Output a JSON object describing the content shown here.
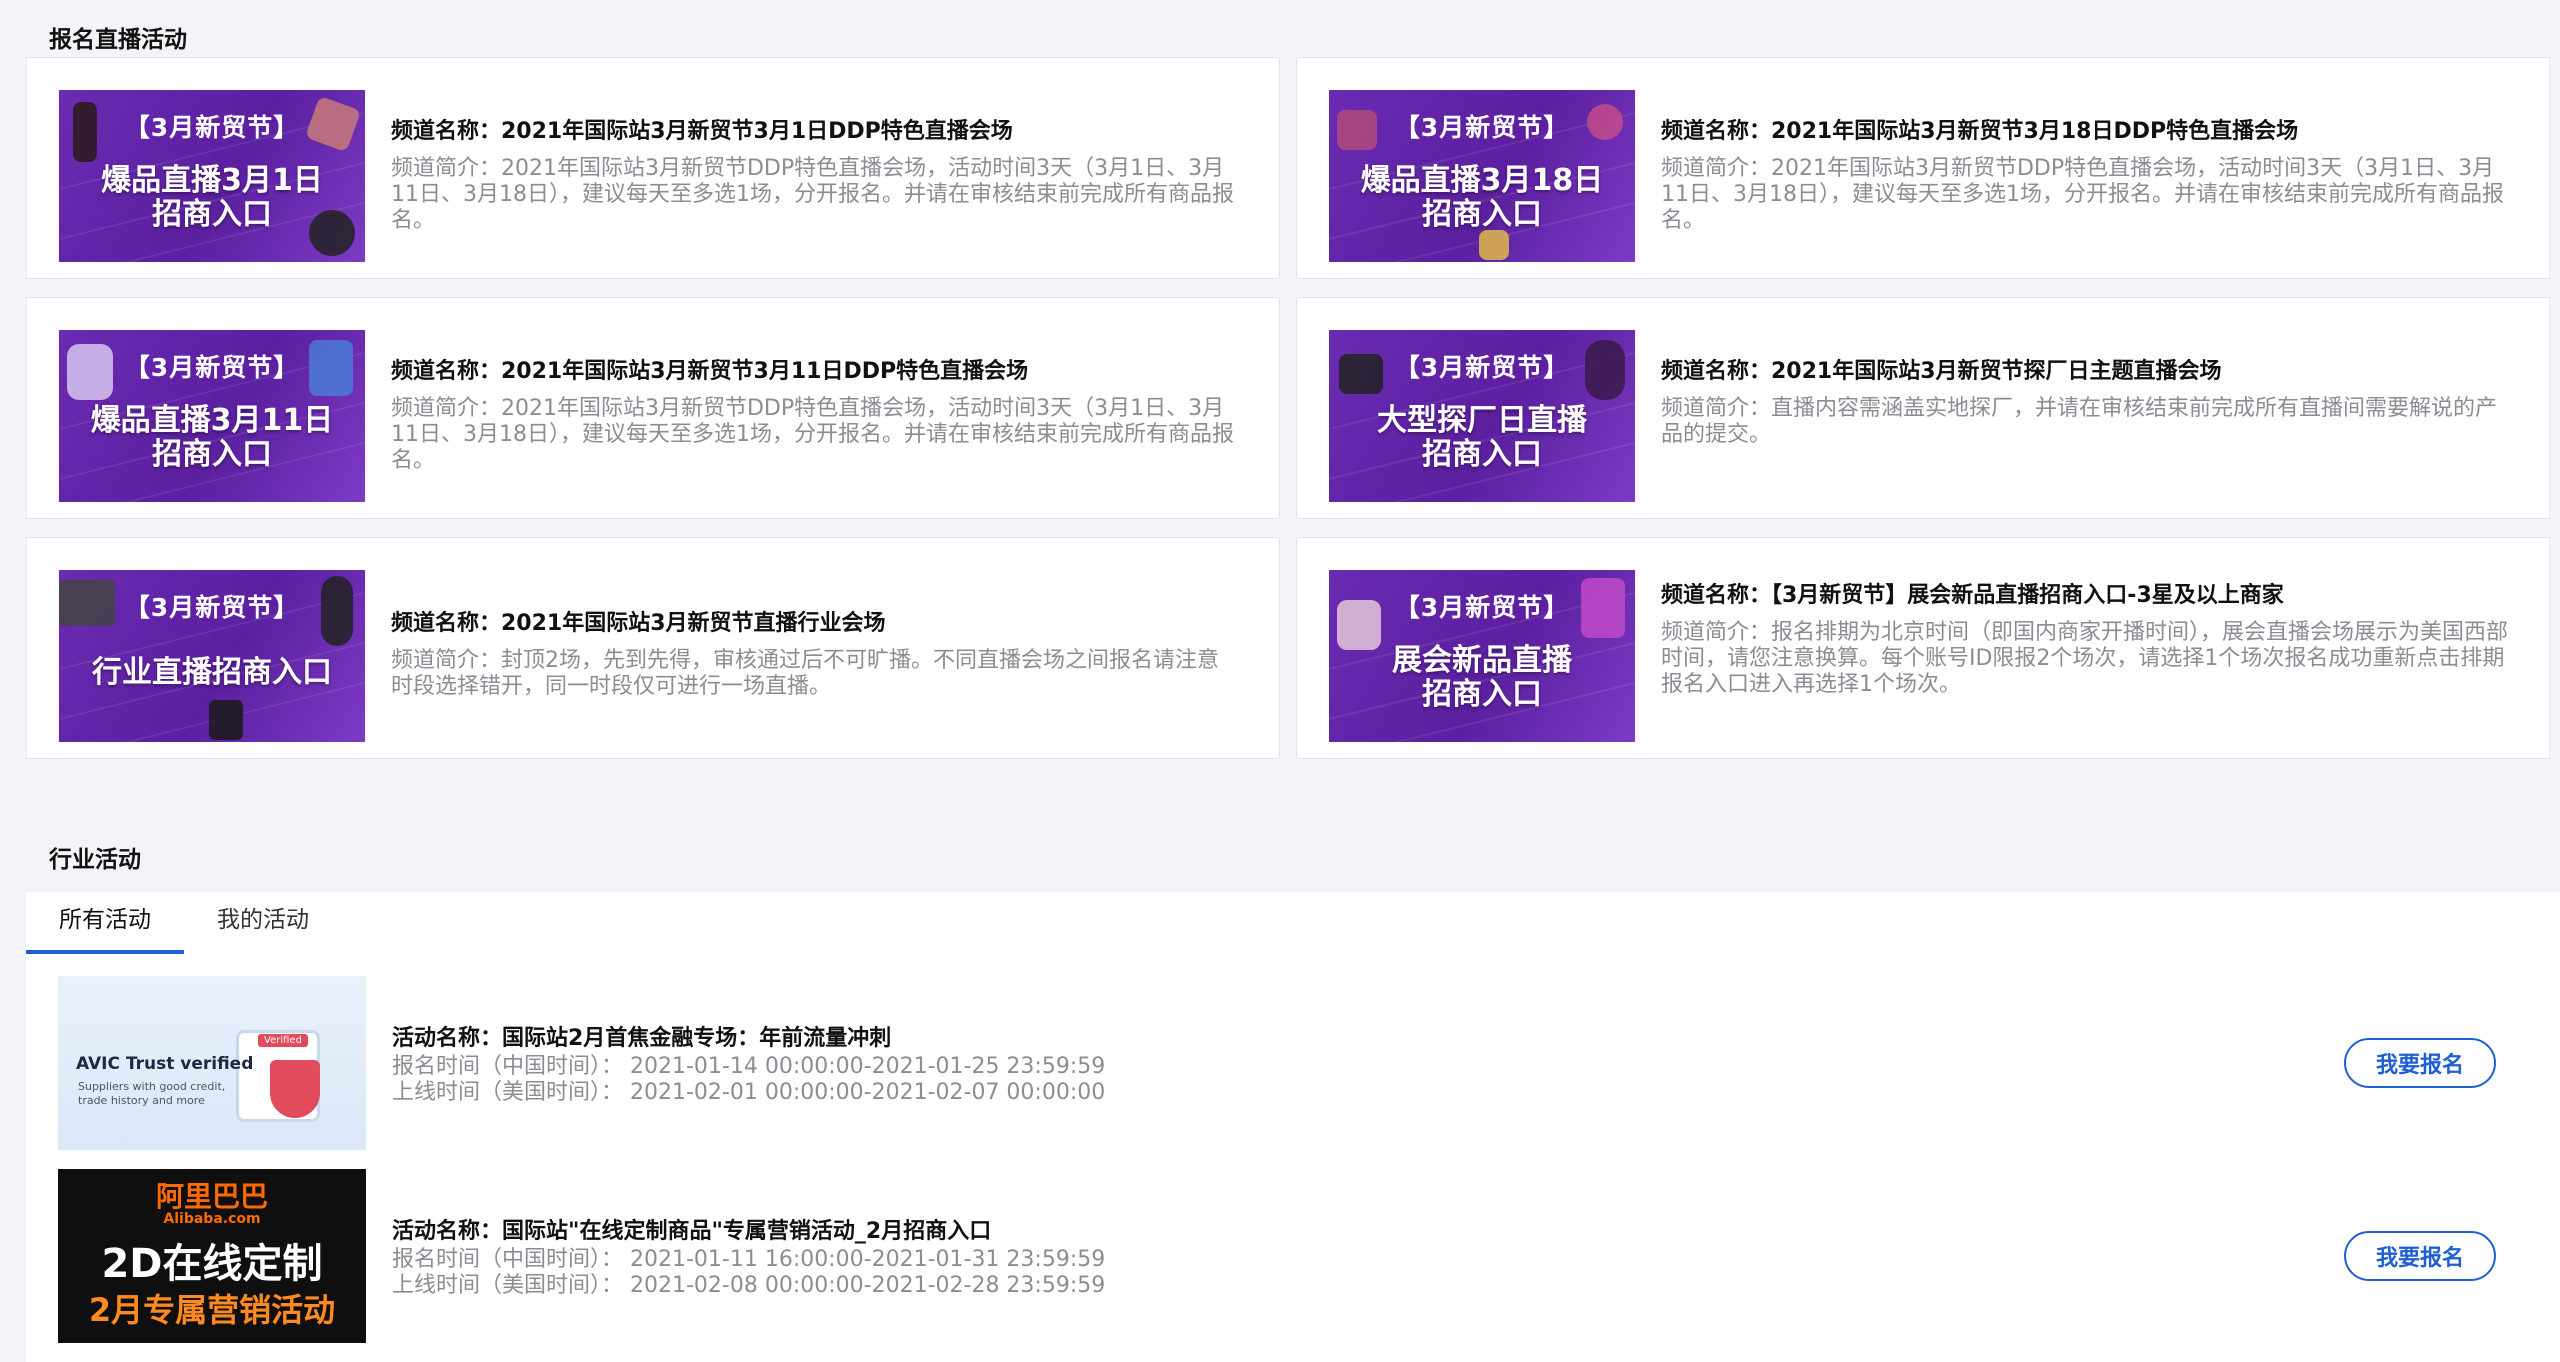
{
  "live_section": {
    "title": "报名直播活动",
    "cards": [
      {
        "thumb_tag": "【3月新贸节】",
        "thumb_headline": "爆品直播3月1日\n招商入口",
        "name": "频道名称：2021年国际站3月新贸节3月1日DDP特色直播会场",
        "desc": "频道简介：2021年国际站3月新贸节DDP特色直播会场，活动时间3天（3月1日、3月11日、3月18日），建议每天至多选1场，分开报名。并请在审核结束前完成所有商品报名。"
      },
      {
        "thumb_tag": "【3月新贸节】",
        "thumb_headline": "爆品直播3月18日\n招商入口",
        "name": "频道名称：2021年国际站3月新贸节3月18日DDP特色直播会场",
        "desc": "频道简介：2021年国际站3月新贸节DDP特色直播会场，活动时间3天（3月1日、3月11日、3月18日），建议每天至多选1场，分开报名。并请在审核结束前完成所有商品报名。"
      },
      {
        "thumb_tag": "【3月新贸节】",
        "thumb_headline": "爆品直播3月11日\n招商入口",
        "name": "频道名称：2021年国际站3月新贸节3月11日DDP特色直播会场",
        "desc": "频道简介：2021年国际站3月新贸节DDP特色直播会场，活动时间3天（3月1日、3月11日、3月18日），建议每天至多选1场，分开报名。并请在审核结束前完成所有商品报名。"
      },
      {
        "thumb_tag": "【3月新贸节】",
        "thumb_headline": "大型探厂日直播\n招商入口",
        "name": "频道名称：2021年国际站3月新贸节探厂日主题直播会场",
        "desc": "频道简介：直播内容需涵盖实地探厂，并请在审核结束前完成所有直播间需要解说的产品的提交。"
      },
      {
        "thumb_tag": "【3月新贸节】",
        "thumb_headline": "行业直播招商入口",
        "name": "频道名称：2021年国际站3月新贸节直播行业会场",
        "desc": "频道简介：封顶2场，先到先得，审核通过后不可旷播。不同直播会场之间报名请注意时段选择错开，同一时段仅可进行一场直播。"
      },
      {
        "thumb_tag": "【3月新贸节】",
        "thumb_headline": "展会新品直播\n招商入口",
        "name": "频道名称：【3月新贸节】展会新品直播招商入口-3星及以上商家",
        "desc": "频道简介：报名排期为北京时间（即国内商家开播时间），展会直播会场展示为美国西部时间，请您注意换算。每个账号ID限报2个场次，请选择1个场次报名成功重新点击排期报名入口进入再选择1个场次。"
      }
    ]
  },
  "industry_section": {
    "title": "行业活动",
    "tabs": [
      "所有活动",
      "我的活动"
    ],
    "activities": [
      {
        "thumb_title": "AVIC Trust verified",
        "thumb_sub": "Suppliers with good credit,\ntrade history and more",
        "thumb_badge": "Verified",
        "name": "活动名称：国际站2月首焦金融专场：年前流量冲刺",
        "signup_time": "报名时间（中国时间）：  2021-01-14 00:00:00-2021-01-25 23:59:59",
        "online_time": "上线时间（美国时间）：  2021-02-01 00:00:00-2021-02-07 00:00:00",
        "button": "我要报名"
      },
      {
        "thumb_logo": "阿里巴巴",
        "thumb_logo_en": "Alibaba.com",
        "thumb_line2": "2D在线定制",
        "thumb_line3": "2月专属营销活动",
        "name": "活动名称：国际站\"在线定制商品\"专属营销活动_2月招商入口",
        "signup_time": "报名时间（中国时间）：  2021-01-11 16:00:00-2021-01-31 23:59:59",
        "online_time": "上线时间（美国时间）：  2021-02-08 00:00:00-2021-02-28 23:59:59",
        "button": "我要报名"
      }
    ]
  },
  "colors": {
    "accent": "#1f5fd3",
    "thumb_purple": "#6a2bb2",
    "muted_text": "#8a8d93"
  }
}
